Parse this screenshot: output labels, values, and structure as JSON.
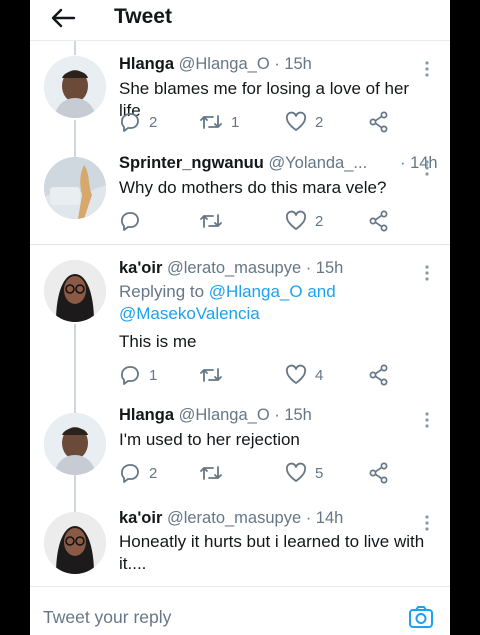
{
  "header": {
    "title": "Tweet"
  },
  "tweets": [
    {
      "name": "Hlanga",
      "handle": "@Hlanga_O · 15h",
      "text": "She blames me for losing a love of her life",
      "replies": "2",
      "retweets": "1",
      "likes": "2"
    },
    {
      "name": "Sprinter_ngwanuu",
      "handle": "@Yolanda_...",
      "time": "· 14h",
      "text": "Why do mothers do this mara vele?",
      "replies": "",
      "retweets": "",
      "likes": "2"
    },
    {
      "name": "ka'oir",
      "handle": "@lerato_masupye · 15h",
      "replying_prefix": "Replying to ",
      "mention1": "@Hlanga_O",
      "and": " and",
      "mention2": "@MasekoValencia",
      "text": "This is me",
      "replies": "1",
      "retweets": "",
      "likes": "4"
    },
    {
      "name": "Hlanga",
      "handle": "@Hlanga_O · 15h",
      "text": "I'm used to her rejection",
      "replies": "2",
      "retweets": "",
      "likes": "5"
    },
    {
      "name": "ka'oir",
      "handle": "@lerato_masupye · 14h",
      "text": "Honeatly it hurts but i learned to live with",
      "text2": "it...."
    }
  ],
  "reply_bar": {
    "placeholder": "Tweet your reply"
  },
  "icons": {
    "back": "back-arrow-icon",
    "reply": "reply-icon",
    "retweet": "retweet-icon",
    "like": "heart-icon",
    "share": "share-icon",
    "more": "more-icon",
    "camera": "camera-icon"
  },
  "colors": {
    "accent": "#1da1f2",
    "muted": "#657786",
    "text": "#14171a"
  }
}
